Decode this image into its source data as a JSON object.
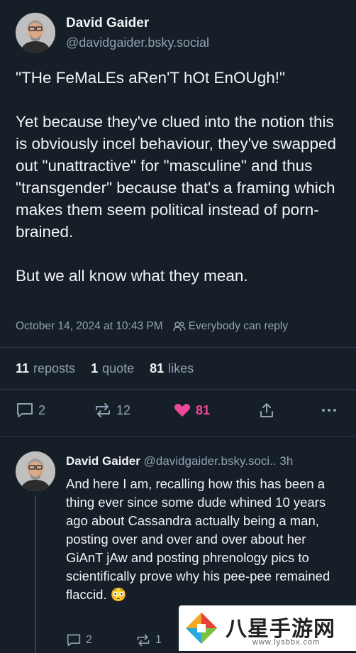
{
  "post": {
    "author_name": "David Gaider",
    "author_handle": "@davidgaider.bsky.social",
    "text": "\"THe FeMaLEs aRen'T hOt EnOUgh!\"\n\nYet because they've clued into the notion this is obviously incel behaviour, they've swapped out \"unattractive\" for \"masculine\" and thus \"transgender\" because that's a framing which makes them seem political instead of porn-brained.\n\nBut we all know what they mean.",
    "timestamp": "October 14, 2024 at 10:43 PM",
    "reply_permission": "Everybody can reply",
    "stats": {
      "reposts_count": "11",
      "reposts_label": "reposts",
      "quotes_count": "1",
      "quotes_label": "quote",
      "likes_count": "81",
      "likes_label": "likes"
    },
    "actions": {
      "reply_count": "2",
      "repost_count": "12",
      "like_count": "81"
    }
  },
  "reply": {
    "author_name": "David Gaider",
    "author_handle": "@davidgaider.bsky.soci..",
    "age": "3h",
    "text": "And here I am, recalling how this has been a thing ever since some dude whined 10 years ago about Cassandra actually being a man, posting over and over and over about her GiAnT jAw and posting phrenology pics to scientifically prove why his pee-pee remained flaccid. 😳",
    "actions": {
      "reply_count": "2",
      "repost_count": "1"
    }
  },
  "watermark": {
    "site_name": "八星手游网",
    "site_url": "www.lysbbx.com"
  },
  "colors": {
    "background": "#161e27",
    "muted_text": "#8fa1b3",
    "like_pink": "#ec4899"
  }
}
